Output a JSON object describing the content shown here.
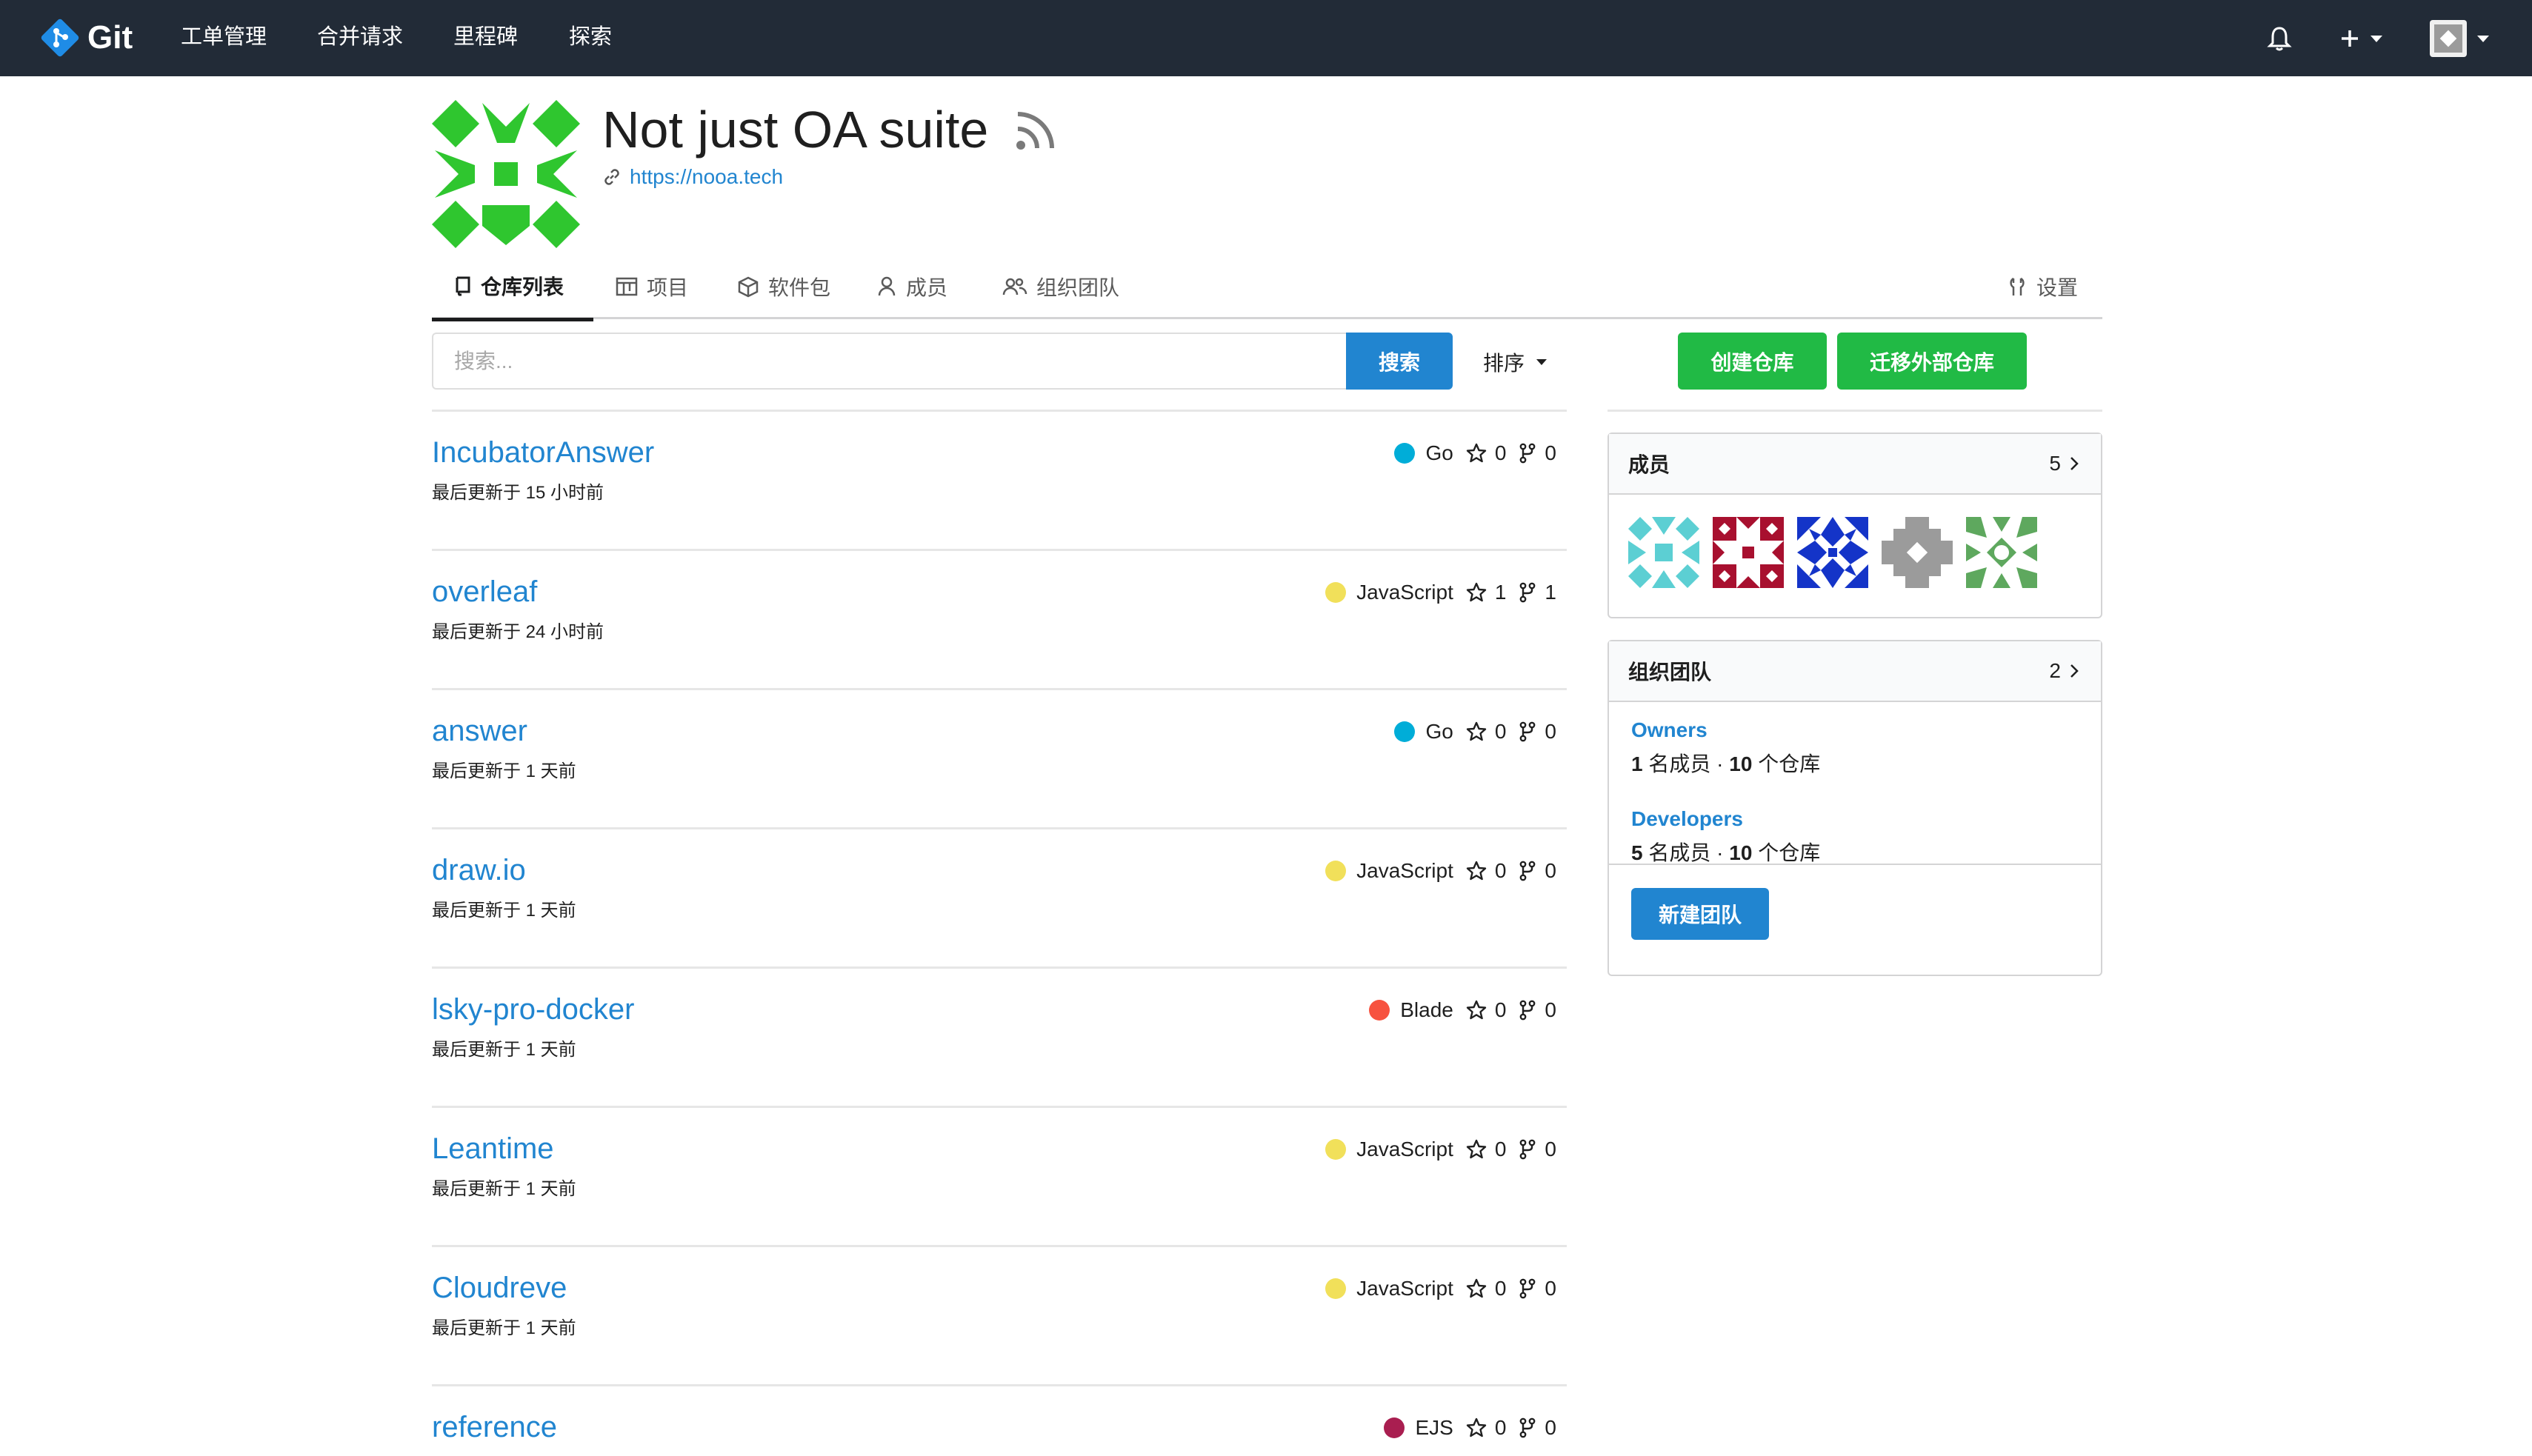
{
  "navbar": {
    "brand": "Git",
    "links": [
      "工单管理",
      "合并请求",
      "里程碑",
      "探索"
    ]
  },
  "org": {
    "title": "Not just OA suite",
    "website": "https://nooa.tech"
  },
  "tabs": [
    {
      "label": "仓库列表",
      "icon": "repo-icon"
    },
    {
      "label": "项目",
      "icon": "project-icon"
    },
    {
      "label": "软件包",
      "icon": "package-icon"
    },
    {
      "label": "成员",
      "icon": "person-icon"
    },
    {
      "label": "组织团队",
      "icon": "people-icon"
    },
    {
      "label": "设置",
      "icon": "tools-icon"
    }
  ],
  "search": {
    "placeholder": "搜索...",
    "button": "搜索",
    "sort_label": "排序"
  },
  "actions": {
    "create_repo": "创建仓库",
    "migrate_repo": "迁移外部仓库"
  },
  "repos": [
    {
      "name": "IncubatorAnswer",
      "updated": "最后更新于 15 小时前",
      "language": "Go",
      "lang_color": "#00add8",
      "stars": "0",
      "forks": "0"
    },
    {
      "name": "overleaf",
      "updated": "最后更新于 24 小时前",
      "language": "JavaScript",
      "lang_color": "#f1e05a",
      "stars": "1",
      "forks": "1"
    },
    {
      "name": "answer",
      "updated": "最后更新于 1 天前",
      "language": "Go",
      "lang_color": "#00add8",
      "stars": "0",
      "forks": "0"
    },
    {
      "name": "draw.io",
      "updated": "最后更新于 1 天前",
      "language": "JavaScript",
      "lang_color": "#f1e05a",
      "stars": "0",
      "forks": "0"
    },
    {
      "name": "lsky-pro-docker",
      "updated": "最后更新于 1 天前",
      "language": "Blade",
      "lang_color": "#f7523f",
      "stars": "0",
      "forks": "0"
    },
    {
      "name": "Leantime",
      "updated": "最后更新于 1 天前",
      "language": "JavaScript",
      "lang_color": "#f1e05a",
      "stars": "0",
      "forks": "0"
    },
    {
      "name": "Cloudreve",
      "updated": "最后更新于 1 天前",
      "language": "JavaScript",
      "lang_color": "#f1e05a",
      "stars": "0",
      "forks": "0"
    },
    {
      "name": "reference",
      "updated": "",
      "language": "EJS",
      "lang_color": "#a91e50",
      "stars": "0",
      "forks": "0"
    }
  ],
  "members_card": {
    "title": "成员",
    "count": "5"
  },
  "teams_card": {
    "title": "组织团队",
    "count": "2",
    "teams": [
      {
        "name": "Owners",
        "members": "1",
        "members_label": "名成员",
        "repos": "10",
        "repos_label": "个仓库"
      },
      {
        "name": "Developers",
        "members": "5",
        "members_label": "名成员",
        "repos": "10",
        "repos_label": "个仓库"
      }
    ],
    "new_team": "新建团队"
  },
  "colors": {
    "navbar": "#222b37",
    "link": "#2185d0",
    "green": "#21ba45",
    "org_avatar": "#2fc62f"
  }
}
